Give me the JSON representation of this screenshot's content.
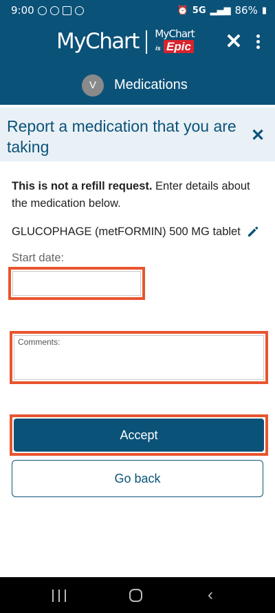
{
  "status_bar": {
    "time": "9:00",
    "network": "5G",
    "battery": "86%"
  },
  "header": {
    "logo_text": "MyChart",
    "epic_logo": {
      "mychart": "MyChart",
      "is": "is",
      "epic": "Epic"
    },
    "avatar_initial": "V",
    "section_title": "Medications"
  },
  "report": {
    "title": "Report a medication that you are taking"
  },
  "form": {
    "notice_bold": "This is not a refill request.",
    "notice_rest": " Enter details about the medication below.",
    "medication_name": "GLUCOPHAGE (metFORMIN) 500 MG tablet",
    "start_date_label": "Start date:",
    "start_date_value": "",
    "comments_label": "Comments:",
    "comments_value": ""
  },
  "buttons": {
    "accept": "Accept",
    "go_back": "Go back"
  },
  "colors": {
    "brand": "#0b5279",
    "highlight": "#e8552e",
    "banner": "#e9f1f6"
  },
  "icons": {
    "header_close": "close-icon",
    "more": "more-vertical-icon",
    "report_close": "close-icon",
    "edit": "pencil-icon"
  }
}
